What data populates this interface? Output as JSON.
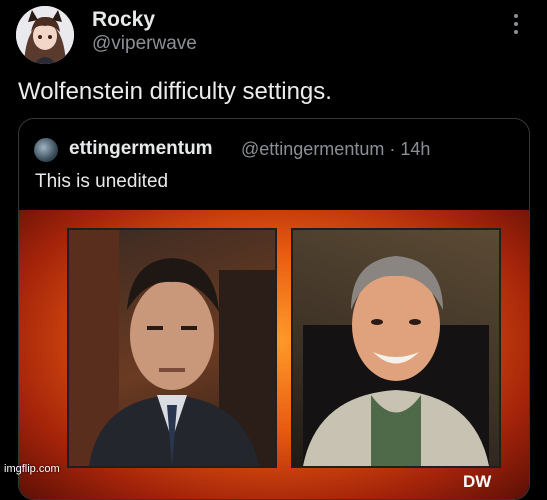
{
  "post": {
    "display_name": "Rocky",
    "handle": "@viperwave",
    "text": "Wolfenstein difficulty settings."
  },
  "quote": {
    "name": "ettingermentum",
    "meta": "@ettingermentum · 14h",
    "text": "This is unedited",
    "media_logo": "DW"
  },
  "watermark": "imgflip.com",
  "icons": {
    "more": "more-vertical-icon"
  },
  "colors": {
    "background": "#000000",
    "muted_text": "#8b9096",
    "card_border": "#33373b"
  }
}
